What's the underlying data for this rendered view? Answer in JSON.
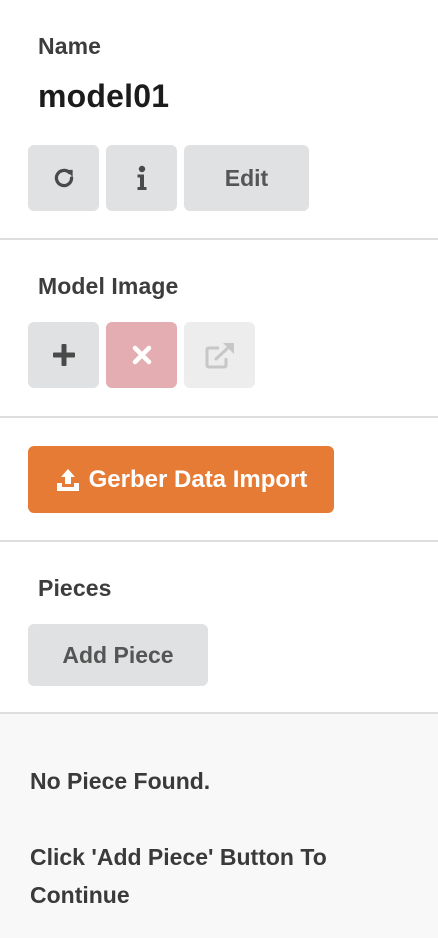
{
  "name_section": {
    "label": "Name",
    "value": "model01",
    "buttons": {
      "refresh_icon": "refresh-icon",
      "info_icon": "info-icon",
      "edit_label": "Edit"
    }
  },
  "model_image": {
    "label": "Model Image",
    "buttons": {
      "add_icon": "plus-icon",
      "remove_icon": "close-icon",
      "open_icon": "external-link-icon"
    }
  },
  "import": {
    "label": "Gerber Data Import",
    "icon": "upload-icon",
    "color": "#e67b35"
  },
  "pieces": {
    "label": "Pieces",
    "add_label": "Add Piece",
    "empty_title": "No Piece Found.",
    "empty_hint": "Click 'Add Piece' Button To Continue"
  }
}
